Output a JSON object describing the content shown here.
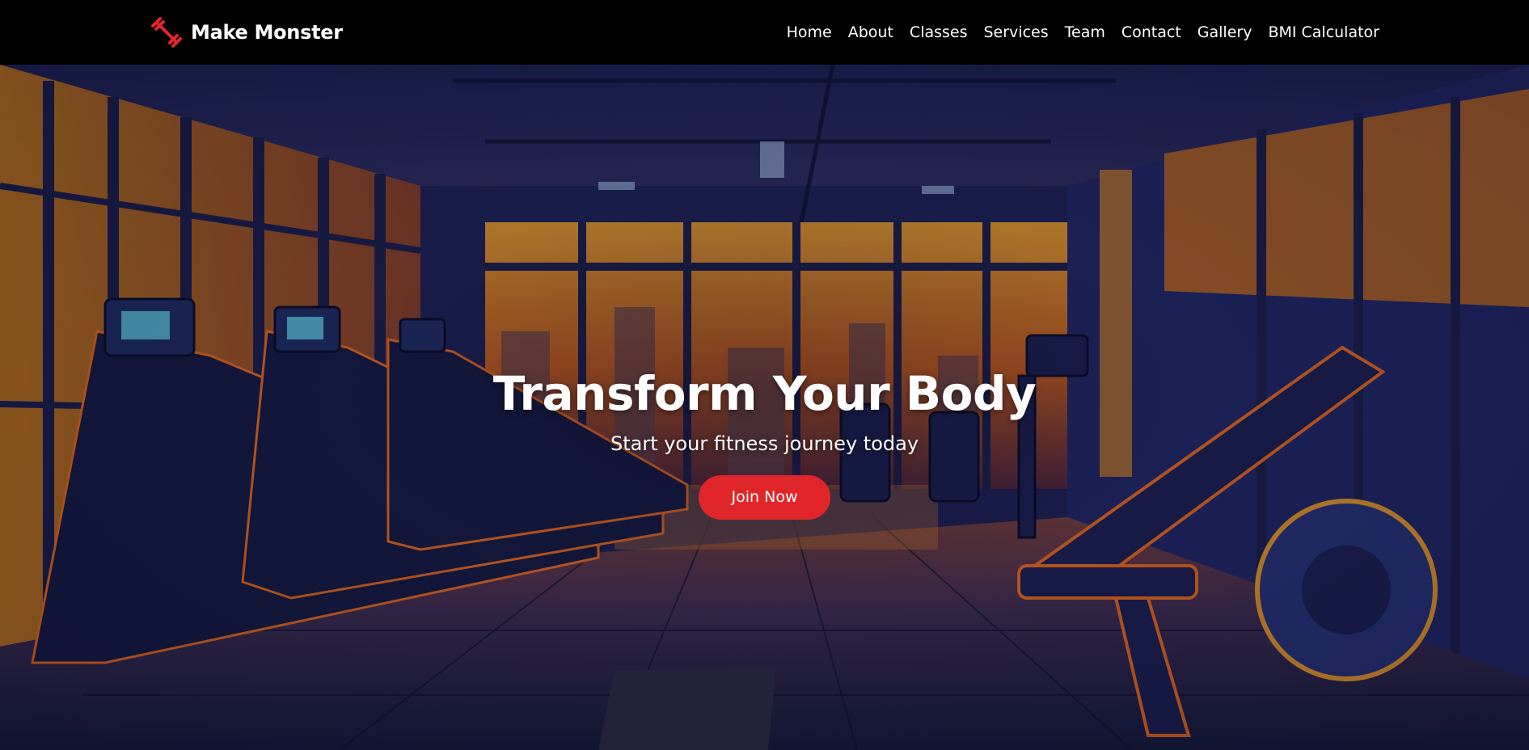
{
  "brand": {
    "name": "Make Monster",
    "icon": "dumbbell-icon",
    "accent_color": "#e1262a"
  },
  "nav": {
    "items": [
      {
        "label": "Home"
      },
      {
        "label": "About"
      },
      {
        "label": "Classes"
      },
      {
        "label": "Services"
      },
      {
        "label": "Team"
      },
      {
        "label": "Contact"
      },
      {
        "label": "Gallery"
      },
      {
        "label": "BMI Calculator"
      }
    ]
  },
  "hero": {
    "title": "Transform Your Body",
    "subtitle": "Start your fitness journey today",
    "cta_label": "Join Now",
    "cta_color": "#e1262a"
  }
}
